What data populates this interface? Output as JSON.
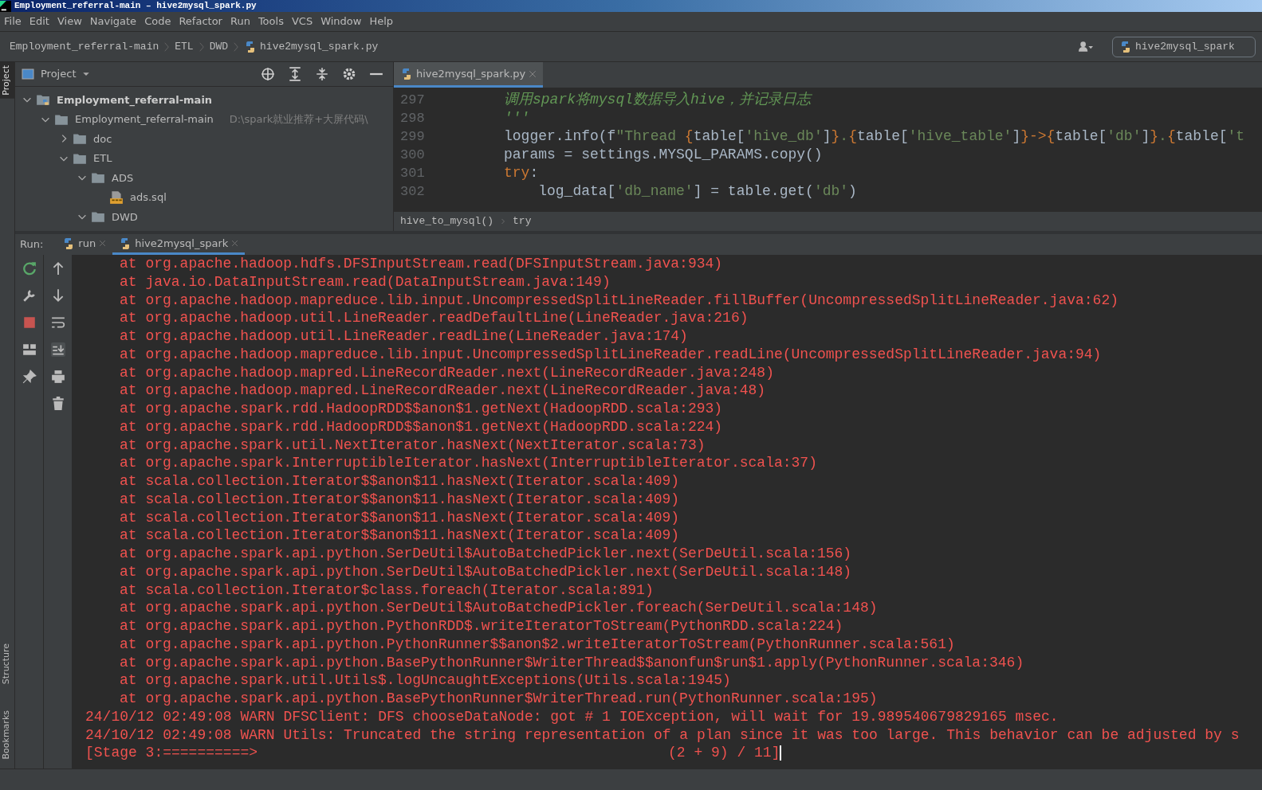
{
  "window": {
    "title": "Employment_referral-main – hive2mysql_spark.py"
  },
  "menu": [
    "File",
    "Edit",
    "View",
    "Navigate",
    "Code",
    "Refactor",
    "Run",
    "Tools",
    "VCS",
    "Window",
    "Help"
  ],
  "breadcrumbs": [
    {
      "label": "Employment_referral-main",
      "kind": "folder"
    },
    {
      "label": "ETL",
      "kind": "folder"
    },
    {
      "label": "DWD",
      "kind": "folder"
    },
    {
      "label": "hive2mysql_spark.py",
      "kind": "python"
    }
  ],
  "run_config": {
    "label": "hive2mysql_spark"
  },
  "side_stripe": {
    "top": [
      {
        "label": "Project",
        "selected": true
      }
    ],
    "bottom": [
      {
        "label": "Structure",
        "selected": false
      },
      {
        "label": "Bookmarks",
        "selected": false
      }
    ]
  },
  "project_panel": {
    "title": "Project",
    "tree": [
      {
        "label": "Employment_referral-main",
        "kind": "module",
        "expanded": true,
        "children": [
          {
            "label": "Employment_referral-main",
            "path": "D:\\spark就业推荐+大屏代码\\",
            "kind": "folder",
            "expanded": true,
            "children": [
              {
                "label": "doc",
                "kind": "folder",
                "expanded": false
              },
              {
                "label": "ETL",
                "kind": "folder",
                "expanded": true,
                "children": [
                  {
                    "label": "ADS",
                    "kind": "folder",
                    "expanded": true,
                    "children": [
                      {
                        "label": "ads.sql",
                        "kind": "sql"
                      }
                    ]
                  },
                  {
                    "label": "DWD",
                    "kind": "folder",
                    "expanded": true
                  }
                ]
              }
            ]
          }
        ]
      }
    ]
  },
  "editor": {
    "tabs": [
      {
        "label": "hive2mysql_spark.py",
        "selected": true
      }
    ],
    "lines": [
      {
        "number": "297",
        "tokens": [
          {
            "text": "调用spark将mysql数据导入hive，并记录日志",
            "kind": "doc"
          }
        ]
      },
      {
        "number": "298",
        "tokens": [
          {
            "text": "'''",
            "kind": "doc"
          }
        ]
      },
      {
        "number": "299",
        "tokens": [
          {
            "text": "logger.info(f",
            "kind": "plain"
          },
          {
            "text": "\"Thread ",
            "kind": "string"
          },
          {
            "text": "{",
            "kind": "keyword"
          },
          {
            "text": "table[",
            "kind": "plain"
          },
          {
            "text": "'hive_db'",
            "kind": "string"
          },
          {
            "text": "]",
            "kind": "plain"
          },
          {
            "text": "}",
            "kind": "keyword"
          },
          {
            "text": ".",
            "kind": "string"
          },
          {
            "text": "{",
            "kind": "keyword"
          },
          {
            "text": "table[",
            "kind": "plain"
          },
          {
            "text": "'hive_table'",
            "kind": "string"
          },
          {
            "text": "]",
            "kind": "plain"
          },
          {
            "text": "}->{",
            "kind": "keyword"
          },
          {
            "text": "table[",
            "kind": "plain"
          },
          {
            "text": "'db'",
            "kind": "string"
          },
          {
            "text": "]",
            "kind": "plain"
          },
          {
            "text": "}",
            "kind": "keyword"
          },
          {
            "text": ".",
            "kind": "string"
          },
          {
            "text": "{",
            "kind": "keyword"
          },
          {
            "text": "table[",
            "kind": "plain"
          },
          {
            "text": "'t",
            "kind": "string"
          }
        ]
      },
      {
        "number": "300",
        "tokens": [
          {
            "text": "params = settings.MYSQL_PARAMS.copy()",
            "kind": "plain"
          }
        ]
      },
      {
        "number": "301",
        "tokens": [
          {
            "text": "try",
            "kind": "keyword"
          },
          {
            "text": ":",
            "kind": "plain"
          }
        ]
      },
      {
        "number": "302",
        "tokens": [
          {
            "text": "    log_data[",
            "kind": "plain"
          },
          {
            "text": "'db_name'",
            "kind": "string"
          },
          {
            "text": "] = table.get(",
            "kind": "plain"
          },
          {
            "text": "'db'",
            "kind": "string"
          },
          {
            "text": ")",
            "kind": "plain"
          }
        ]
      }
    ],
    "breadcrumbs": [
      "hive_to_mysql()",
      "try"
    ]
  },
  "run_panel": {
    "label": "Run:",
    "tabs": [
      {
        "label": "run",
        "selected": false
      },
      {
        "label": "hive2mysql_spark",
        "selected": true
      }
    ],
    "console": [
      {
        "kind": "trace",
        "text": "at org.apache.hadoop.hdfs.DFSInputStream.read(DFSInputStream.java:934)"
      },
      {
        "kind": "trace",
        "text": "at java.io.DataInputStream.read(DataInputStream.java:149)"
      },
      {
        "kind": "trace",
        "text": "at org.apache.hadoop.mapreduce.lib.input.UncompressedSplitLineReader.fillBuffer(UncompressedSplitLineReader.java:62)"
      },
      {
        "kind": "trace",
        "text": "at org.apache.hadoop.util.LineReader.readDefaultLine(LineReader.java:216)"
      },
      {
        "kind": "trace",
        "text": "at org.apache.hadoop.util.LineReader.readLine(LineReader.java:174)"
      },
      {
        "kind": "trace",
        "text": "at org.apache.hadoop.mapreduce.lib.input.UncompressedSplitLineReader.readLine(UncompressedSplitLineReader.java:94)"
      },
      {
        "kind": "trace",
        "text": "at org.apache.hadoop.mapred.LineRecordReader.next(LineRecordReader.java:248)"
      },
      {
        "kind": "trace",
        "text": "at org.apache.hadoop.mapred.LineRecordReader.next(LineRecordReader.java:48)"
      },
      {
        "kind": "trace",
        "text": "at org.apache.spark.rdd.HadoopRDD$$anon$1.getNext(HadoopRDD.scala:293)"
      },
      {
        "kind": "trace",
        "text": "at org.apache.spark.rdd.HadoopRDD$$anon$1.getNext(HadoopRDD.scala:224)"
      },
      {
        "kind": "trace",
        "text": "at org.apache.spark.util.NextIterator.hasNext(NextIterator.scala:73)"
      },
      {
        "kind": "trace",
        "text": "at org.apache.spark.InterruptibleIterator.hasNext(InterruptibleIterator.scala:37)"
      },
      {
        "kind": "trace",
        "text": "at scala.collection.Iterator$$anon$11.hasNext(Iterator.scala:409)"
      },
      {
        "kind": "trace",
        "text": "at scala.collection.Iterator$$anon$11.hasNext(Iterator.scala:409)"
      },
      {
        "kind": "trace",
        "text": "at scala.collection.Iterator$$anon$11.hasNext(Iterator.scala:409)"
      },
      {
        "kind": "trace",
        "text": "at scala.collection.Iterator$$anon$11.hasNext(Iterator.scala:409)"
      },
      {
        "kind": "trace",
        "text": "at org.apache.spark.api.python.SerDeUtil$AutoBatchedPickler.next(SerDeUtil.scala:156)"
      },
      {
        "kind": "trace",
        "text": "at org.apache.spark.api.python.SerDeUtil$AutoBatchedPickler.next(SerDeUtil.scala:148)"
      },
      {
        "kind": "trace",
        "text": "at scala.collection.Iterator$class.foreach(Iterator.scala:891)"
      },
      {
        "kind": "trace",
        "text": "at org.apache.spark.api.python.SerDeUtil$AutoBatchedPickler.foreach(SerDeUtil.scala:148)"
      },
      {
        "kind": "trace",
        "text": "at org.apache.spark.api.python.PythonRDD$.writeIteratorToStream(PythonRDD.scala:224)"
      },
      {
        "kind": "trace",
        "text": "at org.apache.spark.api.python.PythonRunner$$anon$2.writeIteratorToStream(PythonRunner.scala:561)"
      },
      {
        "kind": "trace",
        "text": "at org.apache.spark.api.python.BasePythonRunner$WriterThread$$anonfun$run$1.apply(PythonRunner.scala:346)"
      },
      {
        "kind": "trace",
        "text": "at org.apache.spark.util.Utils$.logUncaughtExceptions(Utils.scala:1945)"
      },
      {
        "kind": "trace",
        "text": "at org.apache.spark.api.python.BasePythonRunner$WriterThread.run(PythonRunner.scala:195)"
      },
      {
        "kind": "log",
        "text": "24/10/12 02:49:08 WARN DFSClient: DFS chooseDataNode: got # 1 IOException, will wait for 19.989540679829165 msec."
      },
      {
        "kind": "log",
        "text": "24/10/12 02:49:08 WARN Utils: Truncated the string representation of a plan since it was too large. This behavior can be adjusted by s"
      },
      {
        "kind": "progress",
        "stage": "[Stage 3:==========>",
        "count": "(2 + 9) / 11]"
      }
    ]
  }
}
